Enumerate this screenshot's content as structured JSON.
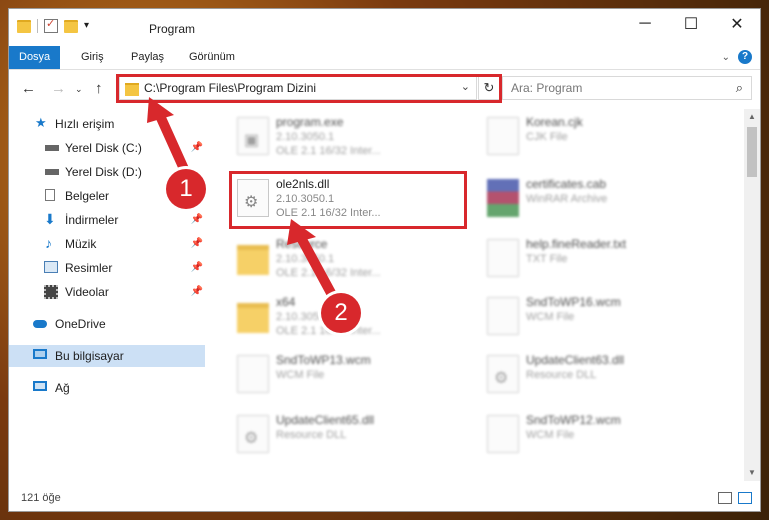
{
  "title": "Program",
  "ribbon": {
    "tabs": [
      "Dosya",
      "Giriş",
      "Paylaş",
      "Görünüm"
    ]
  },
  "address": {
    "path": "C:\\Program Files\\Program Dizini"
  },
  "search": {
    "placeholder": "Ara: Program"
  },
  "sidebar": {
    "items": [
      {
        "label": "Hızlı erişim",
        "icon": "star-icon"
      },
      {
        "label": "Yerel Disk (C:)",
        "icon": "drive-icon"
      },
      {
        "label": "Yerel Disk (D:)",
        "icon": "drive-icon"
      },
      {
        "label": "Belgeler",
        "icon": "document-icon"
      },
      {
        "label": "İndirmeler",
        "icon": "download-icon"
      },
      {
        "label": "Müzik",
        "icon": "music-icon"
      },
      {
        "label": "Resimler",
        "icon": "picture-icon"
      },
      {
        "label": "Videolar",
        "icon": "video-icon"
      },
      {
        "label": "OneDrive",
        "icon": "cloud-icon"
      },
      {
        "label": "Bu bilgisayar",
        "icon": "computer-icon"
      },
      {
        "label": "Ağ",
        "icon": "network-icon"
      }
    ]
  },
  "files": [
    {
      "name": "program.exe",
      "line1": "2.10.3050.1",
      "line2": "OLE 2.1 16/32 Inter...",
      "icon": "exe-icon"
    },
    {
      "name": "Korean.cjk",
      "line1": "CJK File",
      "line2": "",
      "icon": "file-icon"
    },
    {
      "name": "ole2nls.dll",
      "line1": "2.10.3050.1",
      "line2": "OLE 2.1 16/32 Inter...",
      "icon": "dll-icon"
    },
    {
      "name": "certificates.cab",
      "line1": "WinRAR Archive",
      "line2": "",
      "icon": "rar-icon"
    },
    {
      "name": "Resource",
      "line1": "2.10.3050.1",
      "line2": "OLE 2.1 16/32 Inter...",
      "icon": "folder-icon"
    },
    {
      "name": "help.fineReader.txt",
      "line1": "TXT File",
      "line2": "",
      "icon": "file-icon"
    },
    {
      "name": "x64",
      "line1": "2.10.3050.1",
      "line2": "OLE 2.1 16/32 Inter...",
      "icon": "folder-icon"
    },
    {
      "name": "SndToWP16.wcm",
      "line1": "WCM File",
      "line2": "",
      "icon": "file-icon"
    },
    {
      "name": "SndToWP13.wcm",
      "line1": "WCM File",
      "line2": "",
      "icon": "file-icon"
    },
    {
      "name": "UpdateClient63.dll",
      "line1": "Resource DLL",
      "line2": "",
      "icon": "dll-icon"
    },
    {
      "name": "UpdateClient65.dll",
      "line1": "Resource DLL",
      "line2": "",
      "icon": "dll-icon"
    },
    {
      "name": "SndToWP12.wcm",
      "line1": "WCM File",
      "line2": "",
      "icon": "file-icon"
    }
  ],
  "status": {
    "count": "121 öğe"
  },
  "callouts": [
    "1",
    "2"
  ],
  "colors": {
    "accent": "#1979ca",
    "highlight": "#d8282c"
  }
}
